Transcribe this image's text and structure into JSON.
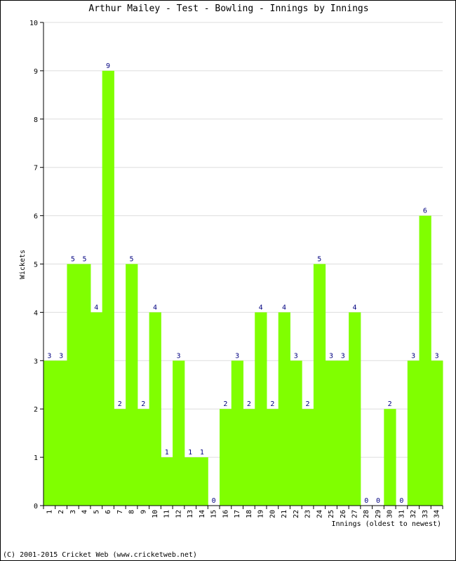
{
  "chart_data": {
    "type": "bar",
    "title": "Arthur Mailey - Test - Bowling - Innings by Innings",
    "xlabel": "Innings (oldest to newest)",
    "ylabel": "Wickets",
    "ylim": [
      0,
      10
    ],
    "yticks": [
      0,
      1,
      2,
      3,
      4,
      5,
      6,
      7,
      8,
      9,
      10
    ],
    "grid": true,
    "bar_color": "#80ff00",
    "label_color": "#000080",
    "categories": [
      "1",
      "2",
      "3",
      "4",
      "5",
      "6",
      "7",
      "8",
      "9",
      "10",
      "11",
      "12",
      "13",
      "14",
      "15",
      "16",
      "17",
      "18",
      "19",
      "20",
      "21",
      "22",
      "23",
      "24",
      "25",
      "26",
      "27",
      "28",
      "29",
      "30",
      "31",
      "32",
      "33",
      "34"
    ],
    "values": [
      3,
      3,
      5,
      5,
      4,
      9,
      2,
      5,
      2,
      4,
      1,
      3,
      1,
      1,
      0,
      2,
      3,
      2,
      4,
      2,
      4,
      3,
      2,
      5,
      3,
      3,
      4,
      0,
      0,
      2,
      0,
      3,
      6,
      3
    ]
  },
  "footer": "(C) 2001-2015 Cricket Web (www.cricketweb.net)"
}
